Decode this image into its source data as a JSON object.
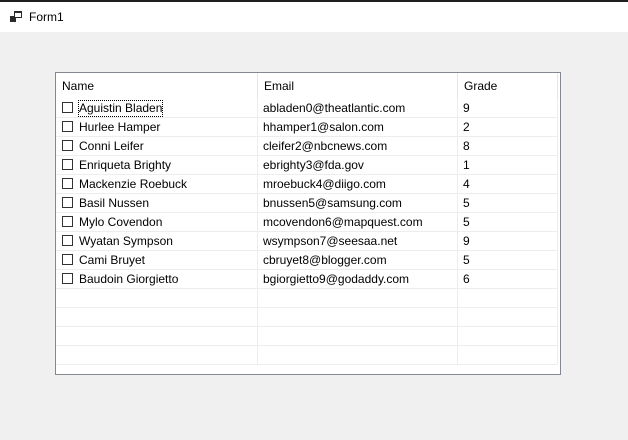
{
  "window": {
    "title": "Form1",
    "icon": "windows-form-icon"
  },
  "listview": {
    "columns": [
      "Name",
      "Email",
      "Grade"
    ],
    "rows": [
      {
        "name": "Aguistin Bladen",
        "email": "abladen0@theatlantic.com",
        "grade": "9",
        "checked": false
      },
      {
        "name": "Hurlee Hamper",
        "email": "hhamper1@salon.com",
        "grade": "2",
        "checked": false
      },
      {
        "name": "Conni Leifer",
        "email": "cleifer2@nbcnews.com",
        "grade": "8",
        "checked": false
      },
      {
        "name": "Enriqueta Brighty",
        "email": "ebrighty3@fda.gov",
        "grade": "1",
        "checked": false
      },
      {
        "name": "Mackenzie Roebuck",
        "email": "mroebuck4@diigo.com",
        "grade": "4",
        "checked": false
      },
      {
        "name": "Basil Nussen",
        "email": "bnussen5@samsung.com",
        "grade": "5",
        "checked": false
      },
      {
        "name": "Mylo Covendon",
        "email": "mcovendon6@mapquest.com",
        "grade": "5",
        "checked": false
      },
      {
        "name": "Wyatan Sympson",
        "email": "wsympson7@seesaa.net",
        "grade": "9",
        "checked": false
      },
      {
        "name": "Cami Bruyet",
        "email": "cbruyet8@blogger.com",
        "grade": "5",
        "checked": false
      },
      {
        "name": "Baudoin Giorgietto",
        "email": "bgiorgietto9@godaddy.com",
        "grade": "6",
        "checked": false
      }
    ],
    "focused_row": 0
  }
}
